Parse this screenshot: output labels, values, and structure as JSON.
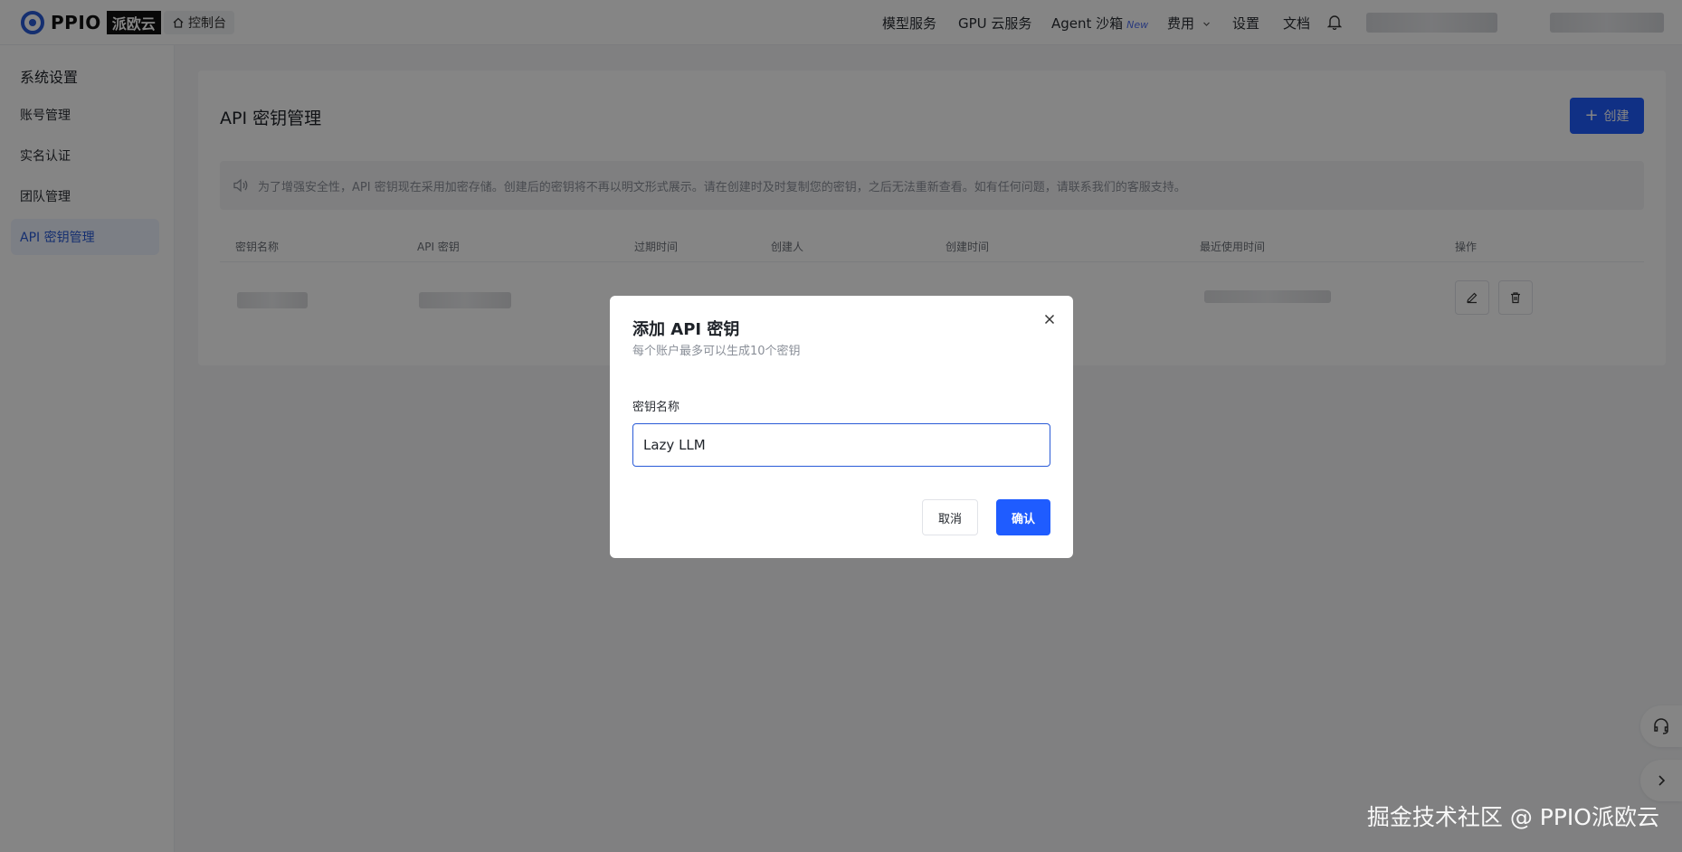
{
  "brand": {
    "name": "PPIO",
    "cn_name": "派欧云"
  },
  "topbar": {
    "console_label": "控制台",
    "nav": {
      "model_service": "模型服务",
      "gpu_service": "GPU 云服务",
      "agent_sandbox": "Agent 沙箱",
      "agent_new_badge": "New",
      "billing": "费用",
      "settings": "设置",
      "docs": "文档"
    }
  },
  "sidebar": {
    "title": "系统设置",
    "items": [
      {
        "label": "账号管理"
      },
      {
        "label": "实名认证"
      },
      {
        "label": "团队管理"
      },
      {
        "label": "API 密钥管理"
      }
    ]
  },
  "main": {
    "title": "API 密钥管理",
    "create_label": "创建",
    "notice": "为了增强安全性，API 密钥现在采用加密存储。创建后的密钥将不再以明文形式展示。请在创建时及时复制您的密钥，之后无法重新查看。如有任何问题，请联系我们的客服支持。",
    "columns": [
      "密钥名称",
      "API 密钥",
      "过期时间",
      "创建人",
      "创建时间",
      "最近使用时间",
      "操作"
    ]
  },
  "modal": {
    "title": "添加 API 密钥",
    "subtitle": "每个账户最多可以生成10个密钥",
    "field_label": "密钥名称",
    "field_value": "Lazy LLM",
    "cancel_label": "取消",
    "confirm_label": "确认"
  },
  "watermark": "掘金技术社区 @ PPIO派欧云",
  "colors": {
    "primary": "#1f5cff",
    "active_bg": "#eef3ff",
    "active_text": "#2a5bd7"
  }
}
